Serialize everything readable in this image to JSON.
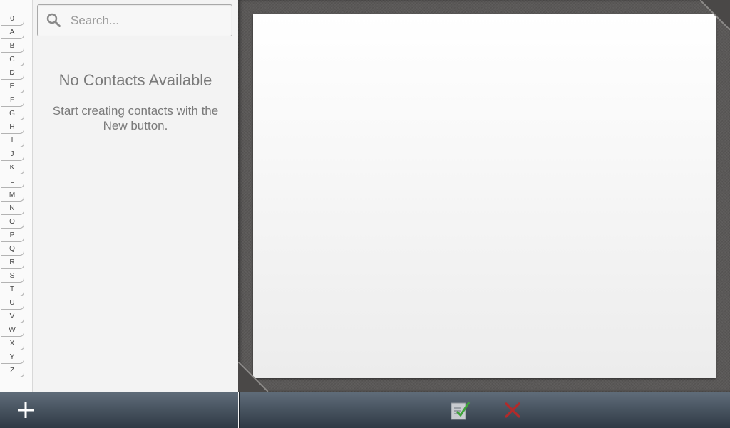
{
  "index": {
    "letters": [
      "0",
      "A",
      "B",
      "C",
      "D",
      "E",
      "F",
      "G",
      "H",
      "I",
      "J",
      "K",
      "L",
      "M",
      "N",
      "O",
      "P",
      "Q",
      "R",
      "S",
      "T",
      "U",
      "V",
      "W",
      "X",
      "Y",
      "Z"
    ]
  },
  "search": {
    "placeholder": "Search...",
    "value": "",
    "icon": "search-icon"
  },
  "empty_state": {
    "title": "No Contacts Available",
    "message": "Start creating contacts with the New button."
  },
  "toolbar": {
    "new_icon": "plus-icon",
    "save_icon": "save-document-check-icon",
    "cancel_icon": "close-x-icon"
  },
  "colors": {
    "accent_check": "#3fa33a",
    "cancel_red": "#b32a2a",
    "toolbar_top": "#5f6c79",
    "toolbar_bottom": "#2f3a45"
  }
}
